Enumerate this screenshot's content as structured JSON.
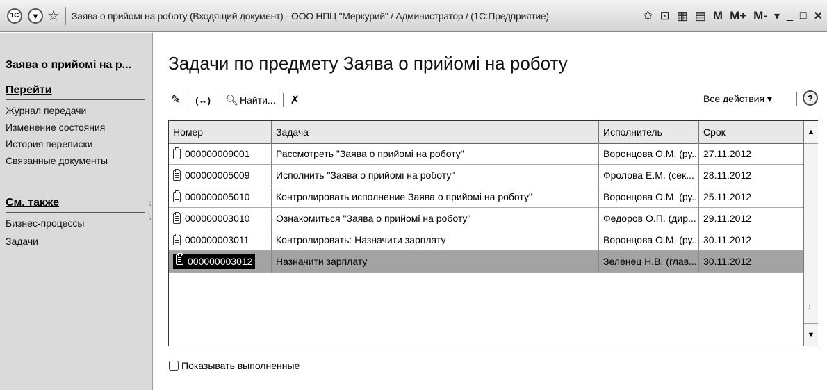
{
  "titlebar": {
    "logo_text": "1C",
    "title": "Заява о прийомі на роботу (Входящий документ) - ООО НПЦ \"Меркурий\" / Администратор / (1С:Предприятие)",
    "m_label": "M",
    "m_plus_label": "M+",
    "m_minus_label": "M-"
  },
  "sidebar": {
    "header": "Заява о прийомі на р...",
    "goto_title": "Перейти",
    "goto_items": [
      "Журнал передачи",
      "Изменение состояния",
      "История переписки",
      "Связанные документы"
    ],
    "see_also_title": "См. также",
    "see_also_items": [
      "Бизнес-процессы",
      "Задачи"
    ]
  },
  "main": {
    "title": "Задачи по предмету Заява о прийомі на роботу",
    "toolbar": {
      "find_label": "Найти...",
      "all_actions_label": "Все действия ▾"
    },
    "table": {
      "columns": [
        "Номер",
        "Задача",
        "Исполнитель",
        "Срок"
      ],
      "rows": [
        {
          "number": "000000009001",
          "task": "Рассмотреть \"Заява о прийомі на роботу\"",
          "executor": "Воронцова О.М. (ру...",
          "due": "27.11.2012"
        },
        {
          "number": "000000005009",
          "task": "Исполнить \"Заява о прийомі на роботу\"",
          "executor": "Фролова Е.М. (сек...",
          "due": "28.11.2012"
        },
        {
          "number": "000000005010",
          "task": "Контролировать исполнение Заява о прийомі на роботу\"",
          "executor": "Воронцова О.М. (ру...",
          "due": "25.11.2012"
        },
        {
          "number": "000000003010",
          "task": "Ознакомиться \"Заява о прийомі на роботу\"",
          "executor": "Федоров О.П. (дир...",
          "due": "29.11.2012"
        },
        {
          "number": "000000003011",
          "task": "Контролировать: Назначити зарплату",
          "executor": "Воронцова О.М. (ру...",
          "due": "30.11.2012"
        },
        {
          "number": "000000003012",
          "task": "Назначити зарплату",
          "executor": "Зеленец Н.В. (глав...",
          "due": "30.11.2012"
        }
      ],
      "selected_index": 5
    },
    "show_completed_label": "Показывать выполненные"
  }
}
